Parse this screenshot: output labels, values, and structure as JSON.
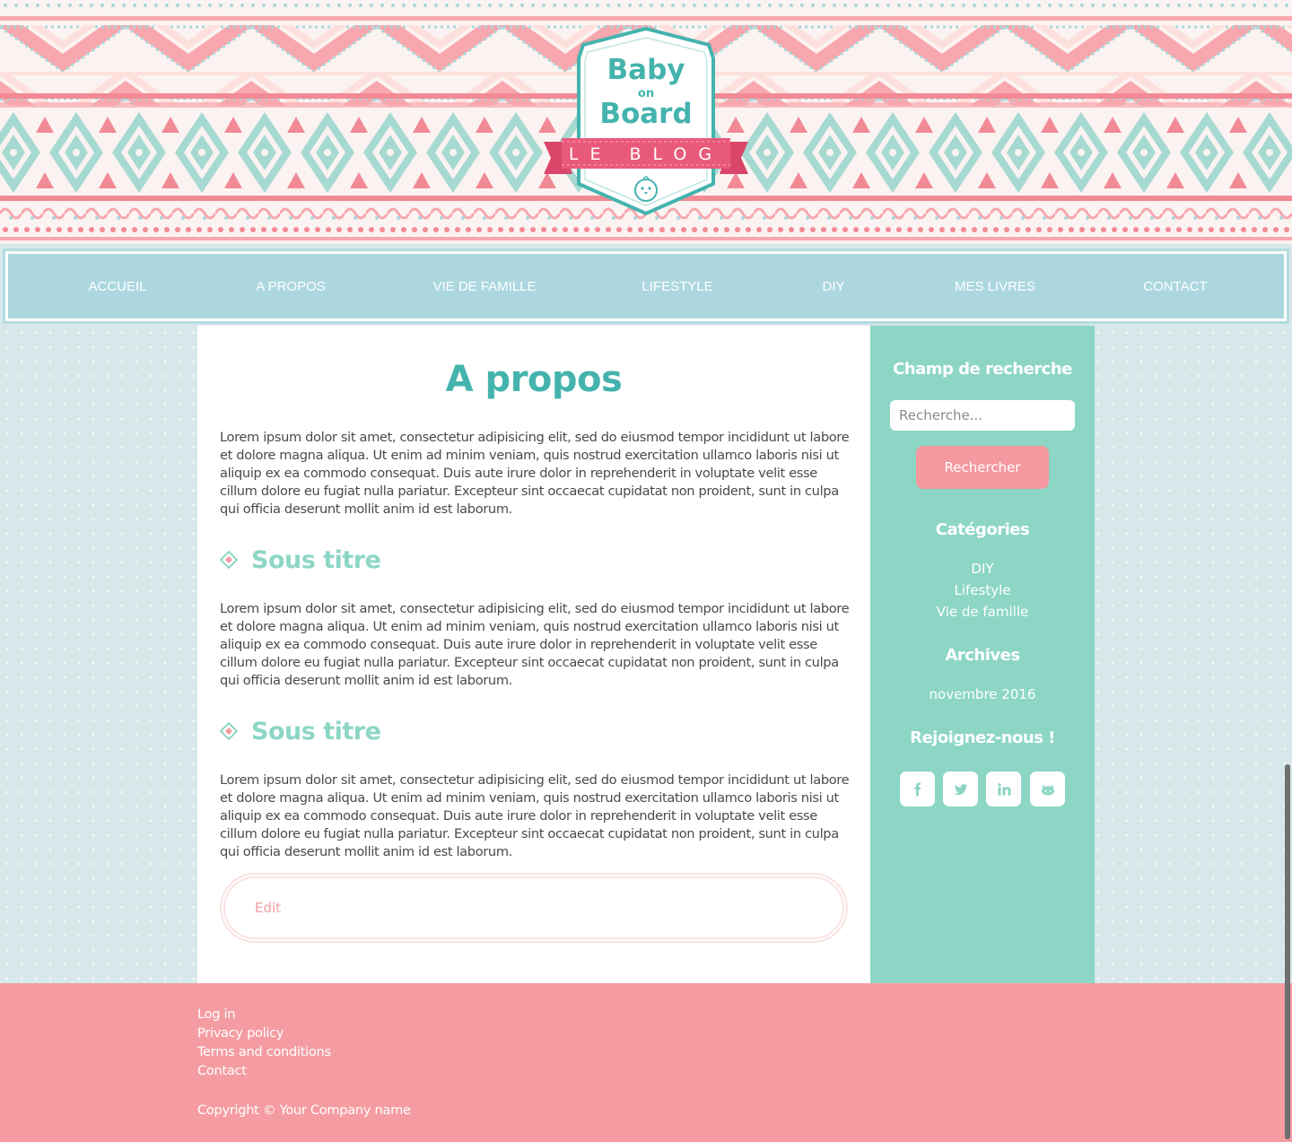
{
  "brand": {
    "line1": "Baby",
    "line2": "on",
    "line3": "Board",
    "ribbon": "LE BLOG",
    "colors": {
      "teal": "#45b3ad",
      "pink": "#e95a7a",
      "mint": "#8dd6c5",
      "coral": "#f49ca1",
      "nav": "#acd7df"
    }
  },
  "nav": {
    "items": [
      {
        "label": "ACCUEIL"
      },
      {
        "label": "A PROPOS"
      },
      {
        "label": "VIE DE FAMILLE"
      },
      {
        "label": "LIFESTYLE"
      },
      {
        "label": "DIY"
      },
      {
        "label": "MES LIVRES"
      },
      {
        "label": "CONTACT"
      }
    ]
  },
  "article": {
    "title": "A propos",
    "paragraphs": [
      "Lorem ipsum dolor sit amet, consectetur adipisicing elit, sed do eiusmod tempor incididunt ut labore et dolore magna aliqua. Ut enim ad minim veniam, quis nostrud exercitation ullamco laboris nisi ut aliquip ex ea commodo consequat. Duis aute irure dolor in reprehenderit in voluptate velit esse cillum dolore eu fugiat nulla pariatur. Excepteur sint occaecat cupidatat non proident, sunt in culpa qui officia deserunt mollit anim id est laborum.",
      "Lorem ipsum dolor sit amet, consectetur adipisicing elit, sed do eiusmod tempor incididunt ut labore et dolore magna aliqua. Ut enim ad minim veniam, quis nostrud exercitation ullamco laboris nisi ut aliquip ex ea commodo consequat. Duis aute irure dolor in reprehenderit in voluptate velit esse cillum dolore eu fugiat nulla pariatur. Excepteur sint occaecat cupidatat non proident, sunt in culpa qui officia deserunt mollit anim id est laborum.",
      "Lorem ipsum dolor sit amet, consectetur adipisicing elit, sed do eiusmod tempor incididunt ut labore et dolore magna aliqua. Ut enim ad minim veniam, quis nostrud exercitation ullamco laboris nisi ut aliquip ex ea commodo consequat. Duis aute irure dolor in reprehenderit in voluptate velit esse cillum dolore eu fugiat nulla pariatur. Excepteur sint occaecat cupidatat non proident, sunt in culpa qui officia deserunt mollit anim id est laborum."
    ],
    "subtitles": [
      "Sous titre",
      "Sous titre"
    ],
    "subtitle_icon": "diamond-icon",
    "edit_label": "Edit"
  },
  "sidebar": {
    "search_heading": "Champ de recherche",
    "search_placeholder": "Recherche...",
    "search_button": "Rechercher",
    "categories_heading": "Catégories",
    "categories": [
      "DIY",
      "Lifestyle",
      "Vie de famille"
    ],
    "archives_heading": "Archives",
    "archives": [
      "novembre 2016"
    ],
    "social_heading": "Rejoignez-nous !",
    "social_icons": [
      "facebook-icon",
      "twitter-icon",
      "linkedin-icon",
      "github-icon"
    ]
  },
  "footer": {
    "links": [
      "Log in",
      "Privacy policy",
      "Terms and conditions",
      "Contact"
    ],
    "copyright": "Copyright © Your Company name"
  }
}
